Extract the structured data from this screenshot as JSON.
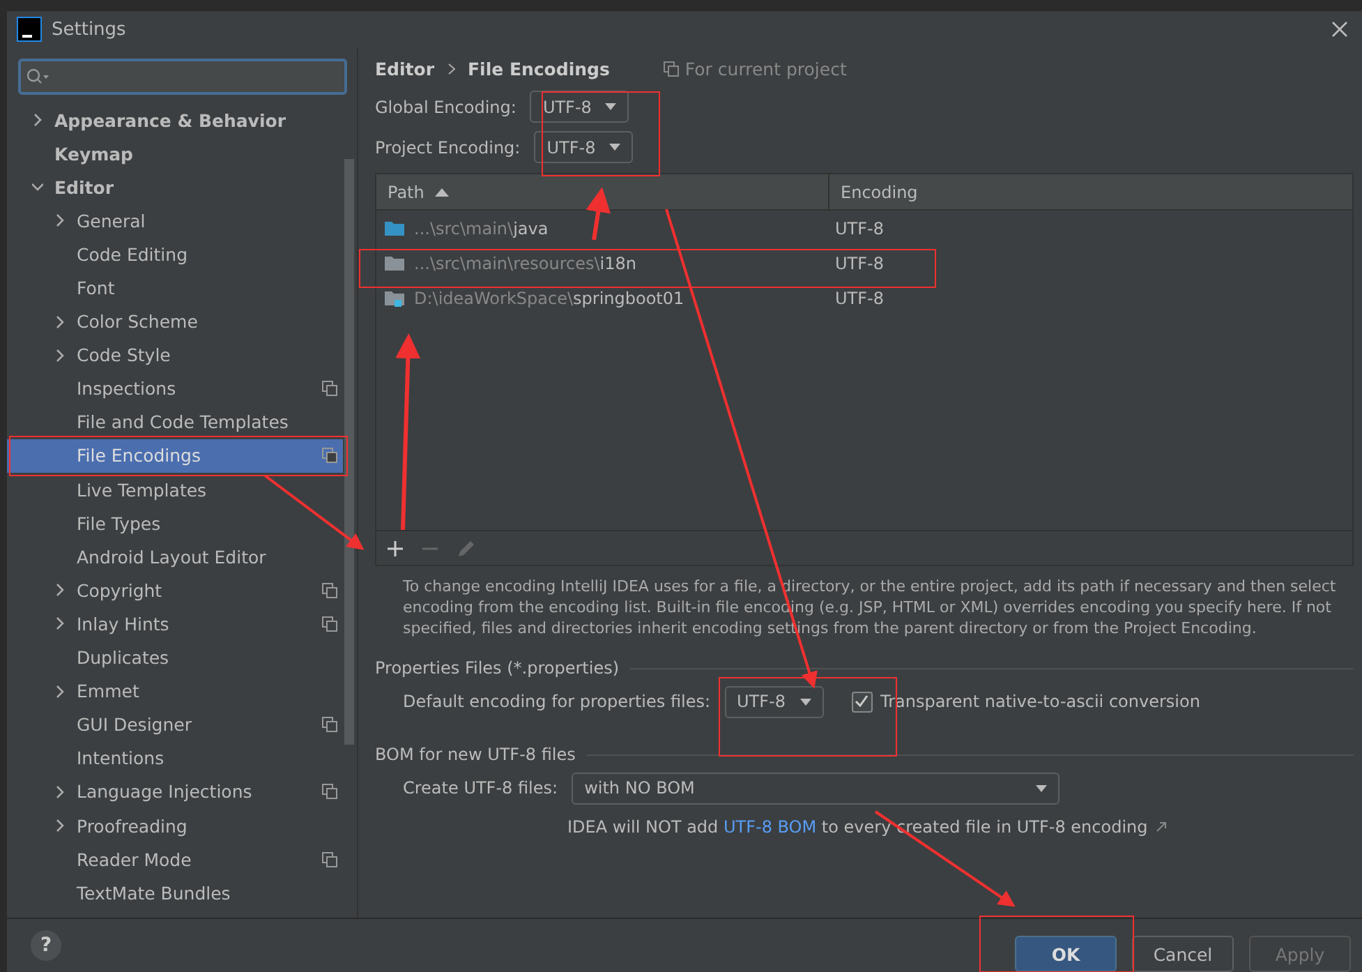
{
  "window": {
    "title": "Settings"
  },
  "sidebar": {
    "items": [
      {
        "label": "Appearance & Behavior",
        "bold": true,
        "expanded": false,
        "expandable": true,
        "selected": false,
        "project": false
      },
      {
        "label": "Keymap",
        "bold": true,
        "expandable": false,
        "selected": false,
        "project": false
      },
      {
        "label": "Editor",
        "bold": true,
        "expandable": true,
        "expanded": true,
        "selected": false,
        "project": false,
        "children": [
          {
            "label": "General",
            "expandable": true,
            "expanded": false,
            "selected": false,
            "project": false
          },
          {
            "label": "Code Editing",
            "expandable": false,
            "selected": false,
            "project": false
          },
          {
            "label": "Font",
            "expandable": false,
            "selected": false,
            "project": false
          },
          {
            "label": "Color Scheme",
            "expandable": true,
            "expanded": false,
            "selected": false,
            "project": false
          },
          {
            "label": "Code Style",
            "expandable": true,
            "expanded": false,
            "selected": false,
            "project": false
          },
          {
            "label": "Inspections",
            "expandable": false,
            "selected": false,
            "project": true
          },
          {
            "label": "File and Code Templates",
            "expandable": false,
            "selected": false,
            "project": false
          },
          {
            "label": "File Encodings",
            "expandable": false,
            "selected": true,
            "project": true
          },
          {
            "label": "Live Templates",
            "expandable": false,
            "selected": false,
            "project": false
          },
          {
            "label": "File Types",
            "expandable": false,
            "selected": false,
            "project": false
          },
          {
            "label": "Android Layout Editor",
            "expandable": false,
            "selected": false,
            "project": false
          },
          {
            "label": "Copyright",
            "expandable": true,
            "expanded": false,
            "selected": false,
            "project": true
          },
          {
            "label": "Inlay Hints",
            "expandable": true,
            "expanded": false,
            "selected": false,
            "project": true
          },
          {
            "label": "Duplicates",
            "expandable": false,
            "selected": false,
            "project": false
          },
          {
            "label": "Emmet",
            "expandable": true,
            "expanded": false,
            "selected": false,
            "project": false
          },
          {
            "label": "GUI Designer",
            "expandable": false,
            "selected": false,
            "project": true
          },
          {
            "label": "Intentions",
            "expandable": false,
            "selected": false,
            "project": false
          },
          {
            "label": "Language Injections",
            "expandable": true,
            "expanded": false,
            "selected": false,
            "project": true
          },
          {
            "label": "Proofreading",
            "expandable": true,
            "expanded": false,
            "selected": false,
            "project": false
          },
          {
            "label": "Reader Mode",
            "expandable": false,
            "selected": false,
            "project": true
          },
          {
            "label": "TextMate Bundles",
            "expandable": false,
            "selected": false,
            "project": false
          }
        ]
      }
    ]
  },
  "breadcrumb": {
    "parent": "Editor",
    "current": "File Encodings",
    "scope": "For current project"
  },
  "global_encoding": {
    "label": "Global Encoding:",
    "value": "UTF-8"
  },
  "project_encoding": {
    "label": "Project Encoding:",
    "value": "UTF-8"
  },
  "table": {
    "columns": [
      "Path",
      "Encoding"
    ],
    "rows": [
      {
        "path": "...\\src\\main\\java",
        "encoding": "UTF-8",
        "kind": "source"
      },
      {
        "path": "...\\src\\main\\resources\\i18n",
        "encoding": "UTF-8",
        "kind": "folder"
      },
      {
        "path": "D:\\ideaWorkSpace\\springboot01",
        "encoding": "UTF-8",
        "kind": "module"
      }
    ]
  },
  "help_text": "To change encoding IntelliJ IDEA uses for a file, a directory, or the entire project, add its path if necessary and then select encoding from the encoding list. Built-in file encoding (e.g. JSP, HTML or XML) overrides encoding you specify here. If not specified, files and directories inherit encoding settings from the parent directory or from the Project Encoding.",
  "properties": {
    "title": "Properties Files (*.properties)",
    "label": "Default encoding for properties files:",
    "value": "UTF-8",
    "checkbox": {
      "label": "Transparent native-to-ascii conversion",
      "checked": true
    }
  },
  "bom": {
    "title": "BOM for new UTF-8 files",
    "label": "Create UTF-8 files:",
    "value": "with NO BOM",
    "note_before": "IDEA will NOT add",
    "note_link": "UTF-8 BOM",
    "note_after": "to every created file in UTF-8 encoding"
  },
  "buttons": [
    {
      "label": "OK",
      "kind": "primary",
      "disabled": false
    },
    {
      "label": "Cancel",
      "kind": "normal",
      "disabled": false
    },
    {
      "label": "Apply",
      "kind": "normal",
      "disabled": true
    }
  ],
  "help_button": "?"
}
